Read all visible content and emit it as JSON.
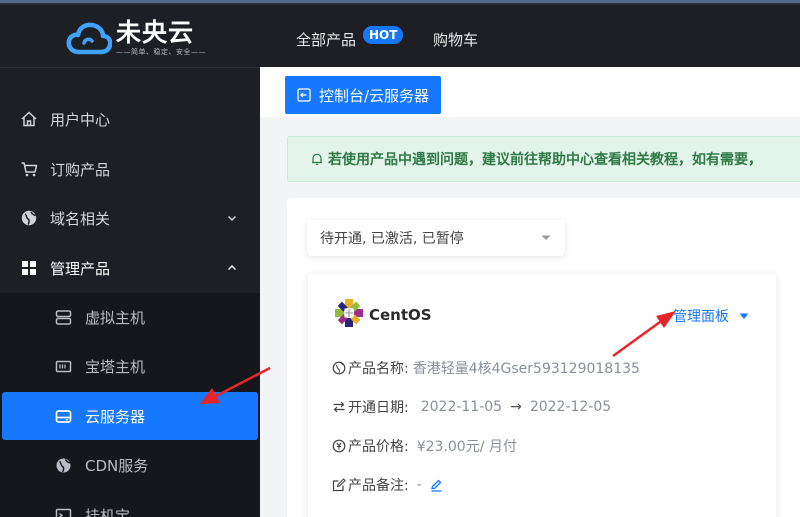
{
  "header": {
    "logo_title": "未央云",
    "logo_subtitle": "——简单、稳定、安全——",
    "nav_all": "全部产品",
    "nav_hot": "HOT",
    "nav_cart": "购物车"
  },
  "sidebar": {
    "items": [
      {
        "label": "用户中心",
        "icon": "home-icon"
      },
      {
        "label": "订购产品",
        "icon": "cart-icon"
      },
      {
        "label": "域名相关",
        "icon": "globe-icon"
      },
      {
        "label": "管理产品",
        "icon": "grid-icon"
      }
    ],
    "sub_items": [
      {
        "label": "虚拟主机",
        "icon": "server-icon"
      },
      {
        "label": "宝塔主机",
        "icon": "panel-icon"
      },
      {
        "label": "云服务器",
        "icon": "disk-icon"
      },
      {
        "label": "CDN服务",
        "icon": "globe-icon"
      },
      {
        "label": "挂机宝",
        "icon": "terminal-icon"
      }
    ]
  },
  "main": {
    "breadcrumb": "控制台/云服务器",
    "notice": "若使用产品中遇到问题，建议前往帮助中心查看相关教程，如有需要，",
    "filter_value": "待开通, 已激活, 已暂停",
    "card": {
      "os_name": "CentOS",
      "manage_label": "管理面板",
      "product_name_label": "产品名称:",
      "product_name_value": "香港轻量4核4Gser593129018135",
      "dates_label": "开通日期:",
      "date_start": "2022-11-05",
      "date_arrow": "→",
      "date_end": "2022-12-05",
      "price_label": "产品价格:",
      "price_value": "¥23.00元/ 月付",
      "note_label": "产品备注:",
      "note_value": "-"
    }
  },
  "colors": {
    "accent": "#1677ff",
    "header_bg": "#1d1f25",
    "notice_bg": "#e3f4ea",
    "notice_text": "#2f7a44",
    "annotation_arrow": "#e8262a"
  }
}
